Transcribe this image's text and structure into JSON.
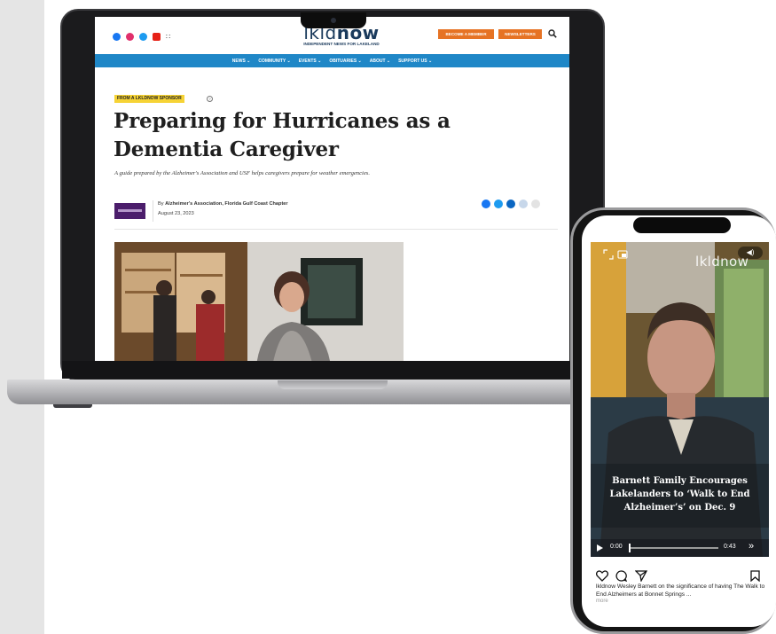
{
  "site": {
    "logo_prefix": "lkld",
    "logo_suffix": "now",
    "logo_tagline": "INDEPENDENT NEWS FOR LAKELAND",
    "become_member": "BECOME A MEMBER",
    "newsletters": "NEWSLETTERS",
    "nav": [
      "NEWS ⌄",
      "COMMUNITY ⌄",
      "EVENTS ⌄",
      "OBITUARIES ⌄",
      "ABOUT ⌄",
      "SUPPORT US ⌄"
    ]
  },
  "article": {
    "sponsor_tag": "FROM A LKLDNOW SPONSOR",
    "headline": "Preparing for Hurricanes as a Dementia Caregiver",
    "dek": "A guide prepared by the Alzheimer's Association and USF helps caregivers prepare for weather emergencies.",
    "byline_prefix": "By",
    "author": "Alzheimer's Association, Florida Gulf Coast Chapter",
    "date": "August 23, 2023"
  },
  "reel": {
    "watermark": "lkldnow",
    "title": "Barnett Family Encourages Lakelanders to ‘Walk to End Alzheimer’s’ on Dec. 9",
    "time_current": "0:00",
    "time_total": "0:43",
    "progress": 0.0,
    "caption_user": "lkldnow",
    "caption_text": "Wesley Barnett on the significance of having The Walk to End Alzheimers at Bonnet Springs ...",
    "more": "more"
  },
  "colors": {
    "accent_orange": "#e67324",
    "nav_blue": "#1f87c7",
    "sponsor_yellow": "#f6d335",
    "brand_purple": "#4b1d6b"
  }
}
